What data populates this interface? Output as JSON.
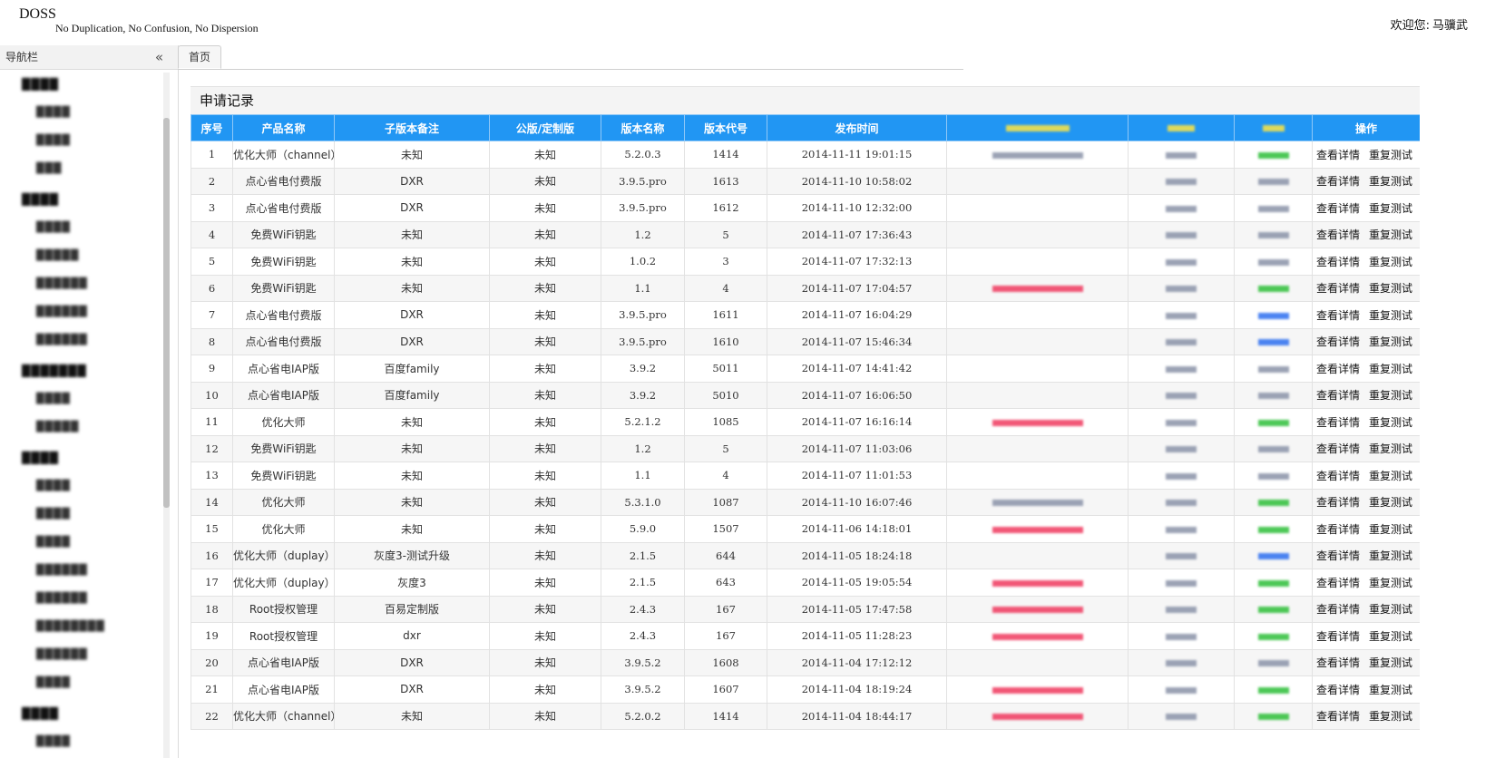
{
  "header": {
    "brand": "DOSS",
    "slogan": "No Duplication, No Confusion, No Dispersion",
    "welcome_label": "欢迎您:",
    "user_name": "马骥武"
  },
  "sidebar": {
    "title": "导航栏",
    "groups": [
      {
        "label": "████",
        "items": [
          "████",
          "████",
          "███"
        ]
      },
      {
        "label": "████",
        "items": [
          "████",
          "█████",
          "██████",
          "██████",
          "██████"
        ]
      },
      {
        "label": "███████",
        "items": [
          "████",
          "█████"
        ]
      },
      {
        "label": "████",
        "items": [
          "████",
          "████",
          "████",
          "██████",
          "██████",
          "████████",
          "██████",
          "████"
        ]
      },
      {
        "label": "████",
        "items": [
          "████"
        ]
      }
    ]
  },
  "tabs": [
    {
      "label": "首页"
    }
  ],
  "panel": {
    "title": "申请记录",
    "columns": [
      "序号",
      "产品名称",
      "子版本备注",
      "公版/定制版",
      "版本名称",
      "版本代号",
      "发布时间",
      "",
      "",
      "",
      "操作"
    ],
    "op_view": "查看详情",
    "op_retest": "重复测试",
    "rows": [
      {
        "no": "1",
        "product": "优化大师（channel）",
        "sub": "未知",
        "edition": "未知",
        "vname": "5.2.0.3",
        "vcode": "1414",
        "time": "2014-11-11 19:01:15"
      },
      {
        "no": "2",
        "product": "点心省电付费版",
        "sub": "DXR",
        "edition": "未知",
        "vname": "3.9.5.pro",
        "vcode": "1613",
        "time": "2014-11-10 10:58:02"
      },
      {
        "no": "3",
        "product": "点心省电付费版",
        "sub": "DXR",
        "edition": "未知",
        "vname": "3.9.5.pro",
        "vcode": "1612",
        "time": "2014-11-10 12:32:00"
      },
      {
        "no": "4",
        "product": "免费WiFi钥匙",
        "sub": "未知",
        "edition": "未知",
        "vname": "1.2",
        "vcode": "5",
        "time": "2014-11-07 17:36:43"
      },
      {
        "no": "5",
        "product": "免费WiFi钥匙",
        "sub": "未知",
        "edition": "未知",
        "vname": "1.0.2",
        "vcode": "3",
        "time": "2014-11-07 17:32:13"
      },
      {
        "no": "6",
        "product": "免费WiFi钥匙",
        "sub": "未知",
        "edition": "未知",
        "vname": "1.1",
        "vcode": "4",
        "time": "2014-11-07 17:04:57"
      },
      {
        "no": "7",
        "product": "点心省电付费版",
        "sub": "DXR",
        "edition": "未知",
        "vname": "3.9.5.pro",
        "vcode": "1611",
        "time": "2014-11-07 16:04:29"
      },
      {
        "no": "8",
        "product": "点心省电付费版",
        "sub": "DXR",
        "edition": "未知",
        "vname": "3.9.5.pro",
        "vcode": "1610",
        "time": "2014-11-07 15:46:34"
      },
      {
        "no": "9",
        "product": "点心省电IAP版",
        "sub": "百度family",
        "edition": "未知",
        "vname": "3.9.2",
        "vcode": "5011",
        "time": "2014-11-07 14:41:42"
      },
      {
        "no": "10",
        "product": "点心省电IAP版",
        "sub": "百度family",
        "edition": "未知",
        "vname": "3.9.2",
        "vcode": "5010",
        "time": "2014-11-07 16:06:50"
      },
      {
        "no": "11",
        "product": "优化大师",
        "sub": "未知",
        "edition": "未知",
        "vname": "5.2.1.2",
        "vcode": "1085",
        "time": "2014-11-07 16:16:14"
      },
      {
        "no": "12",
        "product": "免费WiFi钥匙",
        "sub": "未知",
        "edition": "未知",
        "vname": "1.2",
        "vcode": "5",
        "time": "2014-11-07 11:03:06"
      },
      {
        "no": "13",
        "product": "免费WiFi钥匙",
        "sub": "未知",
        "edition": "未知",
        "vname": "1.1",
        "vcode": "4",
        "time": "2014-11-07 11:01:53"
      },
      {
        "no": "14",
        "product": "优化大师",
        "sub": "未知",
        "edition": "未知",
        "vname": "5.3.1.0",
        "vcode": "1087",
        "time": "2014-11-10 16:07:46"
      },
      {
        "no": "15",
        "product": "优化大师",
        "sub": "未知",
        "edition": "未知",
        "vname": "5.9.0",
        "vcode": "1507",
        "time": "2014-11-06 14:18:01"
      },
      {
        "no": "16",
        "product": "优化大师（duplay）",
        "sub": "灰度3-测试升级",
        "edition": "未知",
        "vname": "2.1.5",
        "vcode": "644",
        "time": "2014-11-05 18:24:18"
      },
      {
        "no": "17",
        "product": "优化大师（duplay）",
        "sub": "灰度3",
        "edition": "未知",
        "vname": "2.1.5",
        "vcode": "643",
        "time": "2014-11-05 19:05:54"
      },
      {
        "no": "18",
        "product": "Root授权管理",
        "sub": "百易定制版",
        "edition": "未知",
        "vname": "2.4.3",
        "vcode": "167",
        "time": "2014-11-05 17:47:58"
      },
      {
        "no": "19",
        "product": "Root授权管理",
        "sub": "dxr",
        "edition": "未知",
        "vname": "2.4.3",
        "vcode": "167",
        "time": "2014-11-05 11:28:23"
      },
      {
        "no": "20",
        "product": "点心省电IAP版",
        "sub": "DXR",
        "edition": "未知",
        "vname": "3.9.5.2",
        "vcode": "1608",
        "time": "2014-11-04 17:12:12"
      },
      {
        "no": "21",
        "product": "点心省电IAP版",
        "sub": "DXR",
        "edition": "未知",
        "vname": "3.9.5.2",
        "vcode": "1607",
        "time": "2014-11-04 18:19:24"
      },
      {
        "no": "22",
        "product": "优化大师（channel）",
        "sub": "未知",
        "edition": "未知",
        "vname": "5.2.0.2",
        "vcode": "1414",
        "time": "2014-11-04 18:44:17"
      }
    ]
  },
  "colors": {
    "header_blue": "#2196f3",
    "mask_red": "#f03a5f",
    "mask_gray": "#8a93a8",
    "mask_green": "#2fbf3a",
    "mask_blue": "#2d6ff0"
  }
}
